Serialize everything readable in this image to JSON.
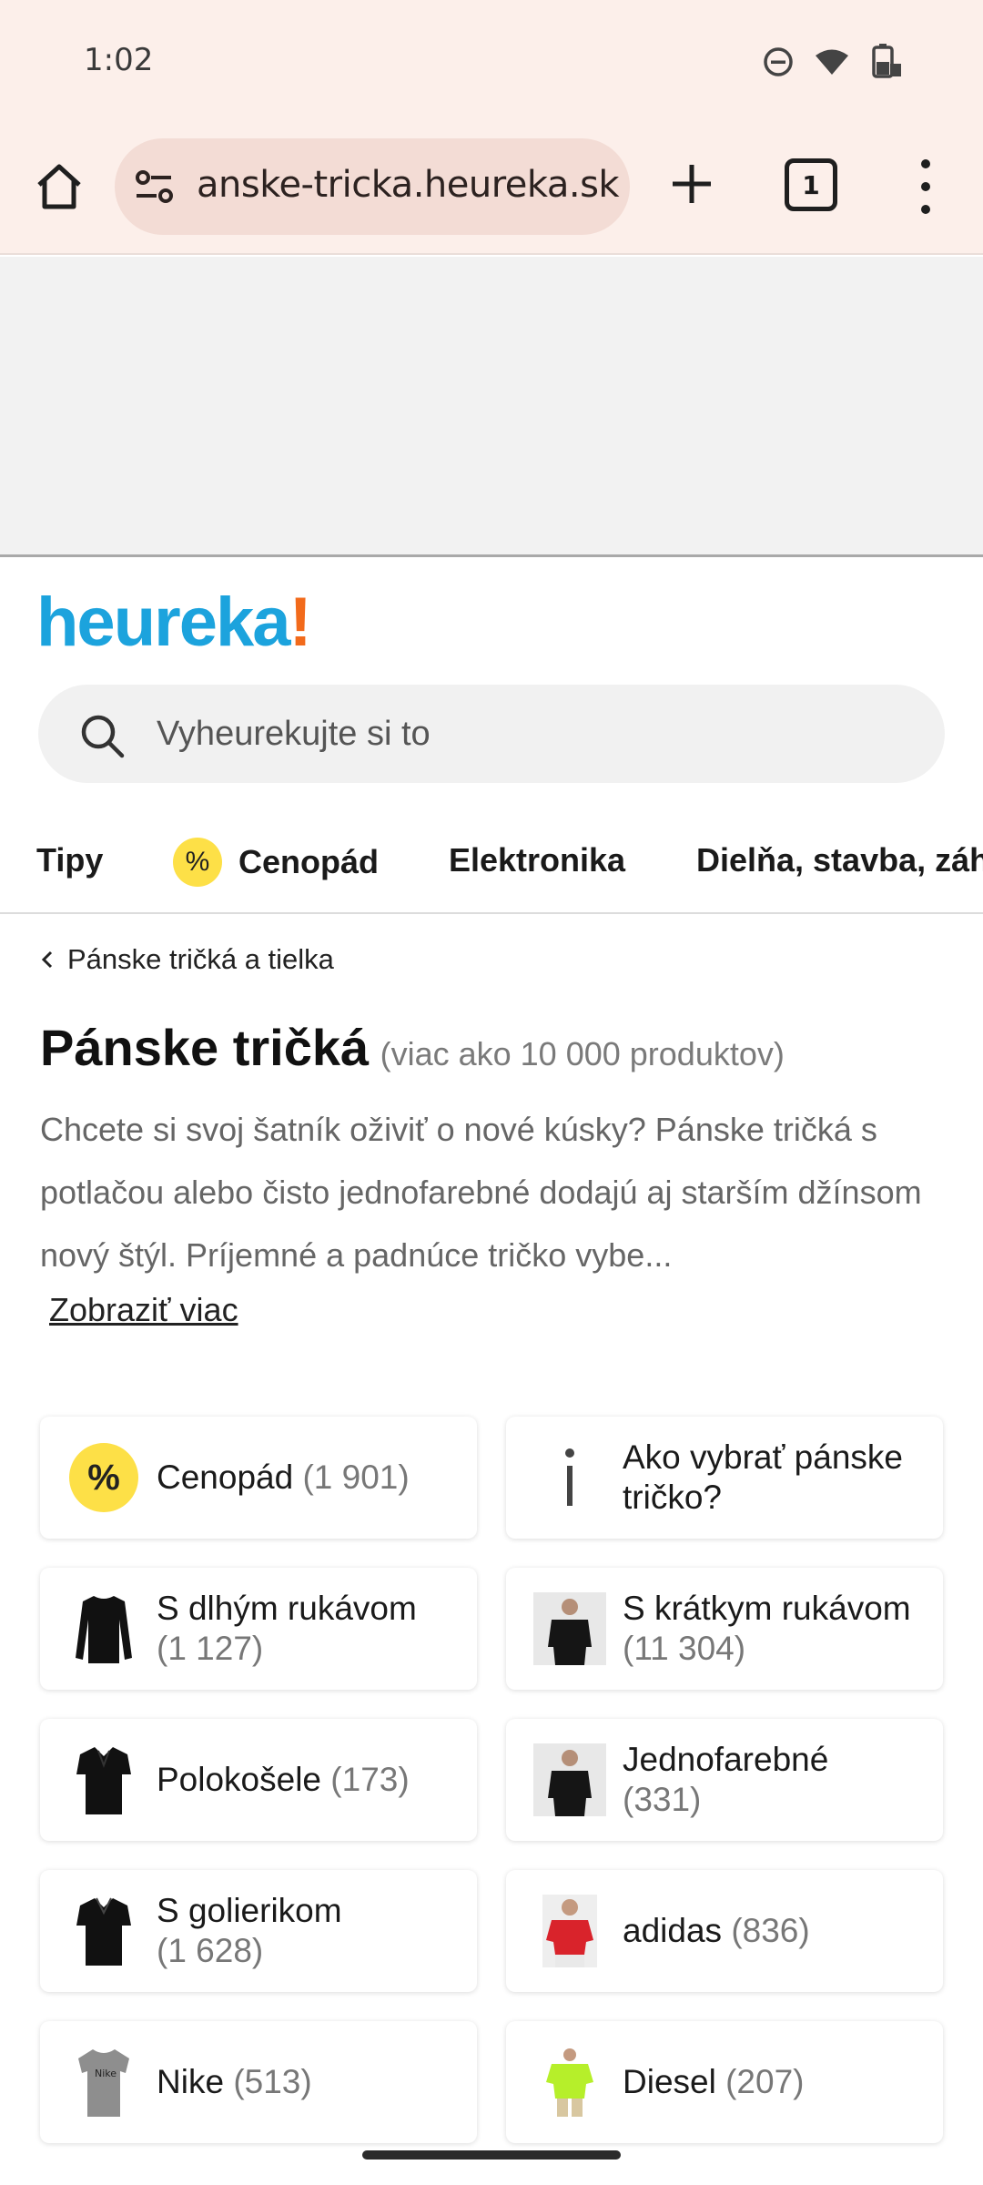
{
  "status_bar": {
    "time": "1:02"
  },
  "browser": {
    "url": "anske-tricka.heureka.sk",
    "tab_count": "1"
  },
  "logo": {
    "main": "heureka",
    "accent": "!"
  },
  "search": {
    "placeholder": "Vyheurekujte si to"
  },
  "categories": [
    {
      "label": "Tipy"
    },
    {
      "label": "Cenopád",
      "badge": "%"
    },
    {
      "label": "Elektronika"
    },
    {
      "label": "Dielňa, stavba, záh"
    }
  ],
  "breadcrumb": {
    "label": "Pánske tričká a tielka"
  },
  "page": {
    "title": "Pánske tričká",
    "count_note": "(viac ako 10 000 produktov)",
    "description": "Chcete si svoj šatník oživiť o nové kúsky? Pánske tričká s potlačou alebo čisto jednofarebné dodajú aj starším džínsom nový štýl. Príjemné a padnúce tričko vybe...",
    "more_link": "Zobraziť viac"
  },
  "tiles": [
    {
      "name": "Cenopád",
      "count": "(1 901)",
      "icon": "percent-badge"
    },
    {
      "name": "Ako vybrať pánske tričko?",
      "count": "",
      "icon": "info-icon"
    },
    {
      "name": "S dlhým rukávom",
      "count": "(1 127)",
      "icon": "long-sleeve-shirt"
    },
    {
      "name": "S krátkym rukávom",
      "count": "(11 304)",
      "icon": "short-sleeve-photo"
    },
    {
      "name": "Polokošele",
      "count": "(173)",
      "icon": "polo-shirt"
    },
    {
      "name": "Jednofarebné",
      "count": "(331)",
      "icon": "plain-tshirt-photo"
    },
    {
      "name": "S golierikom",
      "count": "(1 628)",
      "icon": "collar-shirt"
    },
    {
      "name": "adidas",
      "count": "(836)",
      "icon": "red-tshirt-photo"
    },
    {
      "name": "Nike",
      "count": "(513)",
      "icon": "grey-tshirt"
    },
    {
      "name": "Diesel",
      "count": "(207)",
      "icon": "lime-tshirt-photo"
    }
  ],
  "colors": {
    "brand_blue": "#1ca3dd",
    "brand_orange": "#f26a1b",
    "badge_yellow": "#fde047",
    "browser_chrome": "#fcefea"
  }
}
